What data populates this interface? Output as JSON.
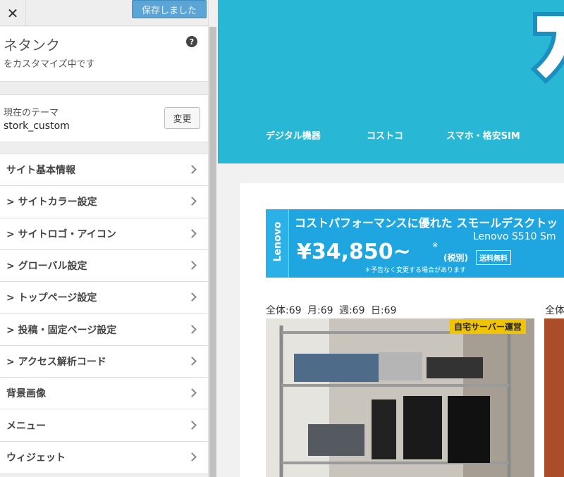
{
  "header": {
    "close_glyph": "✕",
    "save_label": "保存しました"
  },
  "panel": {
    "site_name": "ネタンク",
    "customizing": "をカスタマイズ中です",
    "help_glyph": "?"
  },
  "theme": {
    "label": "現在のテーマ",
    "name": "stork_custom",
    "change_label": "変更"
  },
  "menu": [
    {
      "label": "サイト基本情報"
    },
    {
      "label": "> サイトカラー設定"
    },
    {
      "label": "> サイトロゴ・アイコン"
    },
    {
      "label": "> グローバル設定"
    },
    {
      "label": "> トップページ設定"
    },
    {
      "label": "> 投稿・固定ページ設定"
    },
    {
      "label": "> アクセス解析コード"
    },
    {
      "label": "背景画像"
    },
    {
      "label": "メニュー"
    },
    {
      "label": "ウィジェット"
    }
  ],
  "preview": {
    "nav": [
      "デジタル機器",
      "コストコ",
      "スマホ・格安SIM"
    ],
    "banner": {
      "brand": "Lenovo",
      "headline": "コストパフォーマンスに優れた スモールデスクトッ",
      "model": "Lenovo S510 Sm",
      "price": "¥34,850~",
      "price_note": "※",
      "tax": "(税別)",
      "shipping": "送料無料",
      "notice": "＊予告なく変更する場合があります"
    },
    "stats": "全体:69  月:69  週:69  日:69",
    "stats_second": "全体",
    "post_tag": "自宅サーバー運営"
  },
  "colors": {
    "header_bg": "#29b7d6",
    "save_button": "#5aa5d6",
    "tag": "#f1c400"
  }
}
